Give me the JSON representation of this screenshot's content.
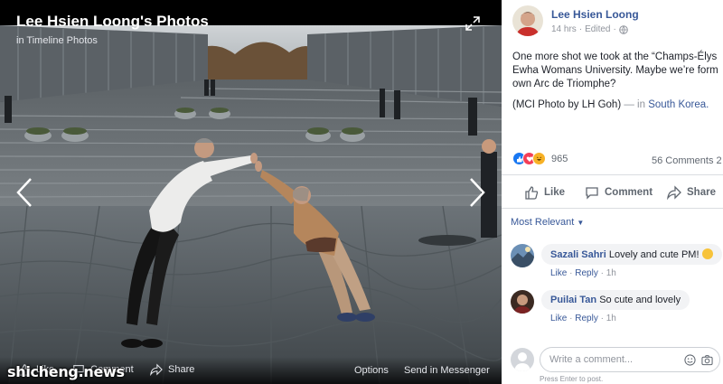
{
  "viewer": {
    "title": "Lee Hsien Loong's Photos",
    "subtitle": "in Timeline Photos",
    "bottom_bar": {
      "like": "Like",
      "comment": "Comment",
      "share": "Share",
      "options": "Options",
      "send": "Send in Messenger"
    },
    "watermark": "shicheng.news"
  },
  "post": {
    "author": "Lee Hsien Loong",
    "time": "14 hrs",
    "edited": "Edited",
    "text_lines": [
      "One more shot we took at the “Champs-Élys",
      "Ewha Womans University. Maybe we’re form",
      "own Arc de Triomphe?"
    ],
    "credit": "(MCI Photo by LH Goh)",
    "credit_sep": "— in",
    "location": "South Korea.",
    "reactions_count": "965",
    "comments_count": "56 Comments  2",
    "actions": {
      "like": "Like",
      "comment": "Comment",
      "share": "Share"
    },
    "sort_label": "Most Relevant",
    "comments": [
      {
        "author": "Sazali Sahri",
        "text": "Lovely and cute PM!",
        "like": "Like",
        "reply": "Reply",
        "time": "1h"
      },
      {
        "author": "Puilai Tan",
        "text": "So cute and lovely",
        "like": "Like",
        "reply": "Reply",
        "time": "1h"
      }
    ],
    "write_placeholder": "Write a comment...",
    "press_enter": "Press Enter to post."
  },
  "colors": {
    "link": "#385898",
    "panel_bg": "#ffffff",
    "bubble_bg": "#f2f3f5",
    "like_blue": "#1877f2",
    "love_red": "#f33e58",
    "haha_yellow": "#f7b125"
  }
}
